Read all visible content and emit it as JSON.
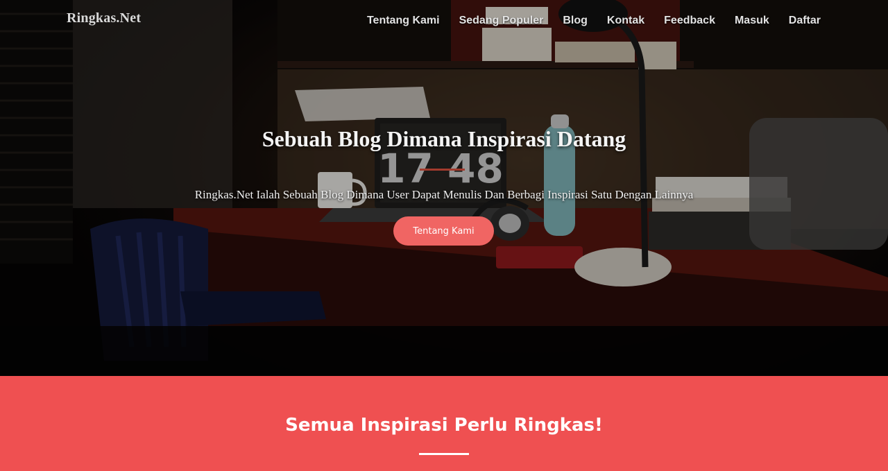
{
  "navbar": {
    "brand": "Ringkas.Net",
    "links": [
      "Tentang Kami",
      "Sedang Populer",
      "Blog",
      "Kontak",
      "Feedback",
      "Masuk",
      "Daftar"
    ]
  },
  "hero": {
    "title": "Sebuah Blog Dimana Inspirasi Datang",
    "subtitle": "Ringkas.Net Ialah Sebuah Blog Dimana User Dapat Menulis Dan Berbagi Inspirasi Satu Dengan Lainnya",
    "button_label": "Tentang Kami",
    "laptop_clock": "17 48"
  },
  "section": {
    "title": "Semua Inspirasi Perlu Ringkas!"
  },
  "colors": {
    "accent": "#ef5051",
    "button": "#f06563"
  }
}
